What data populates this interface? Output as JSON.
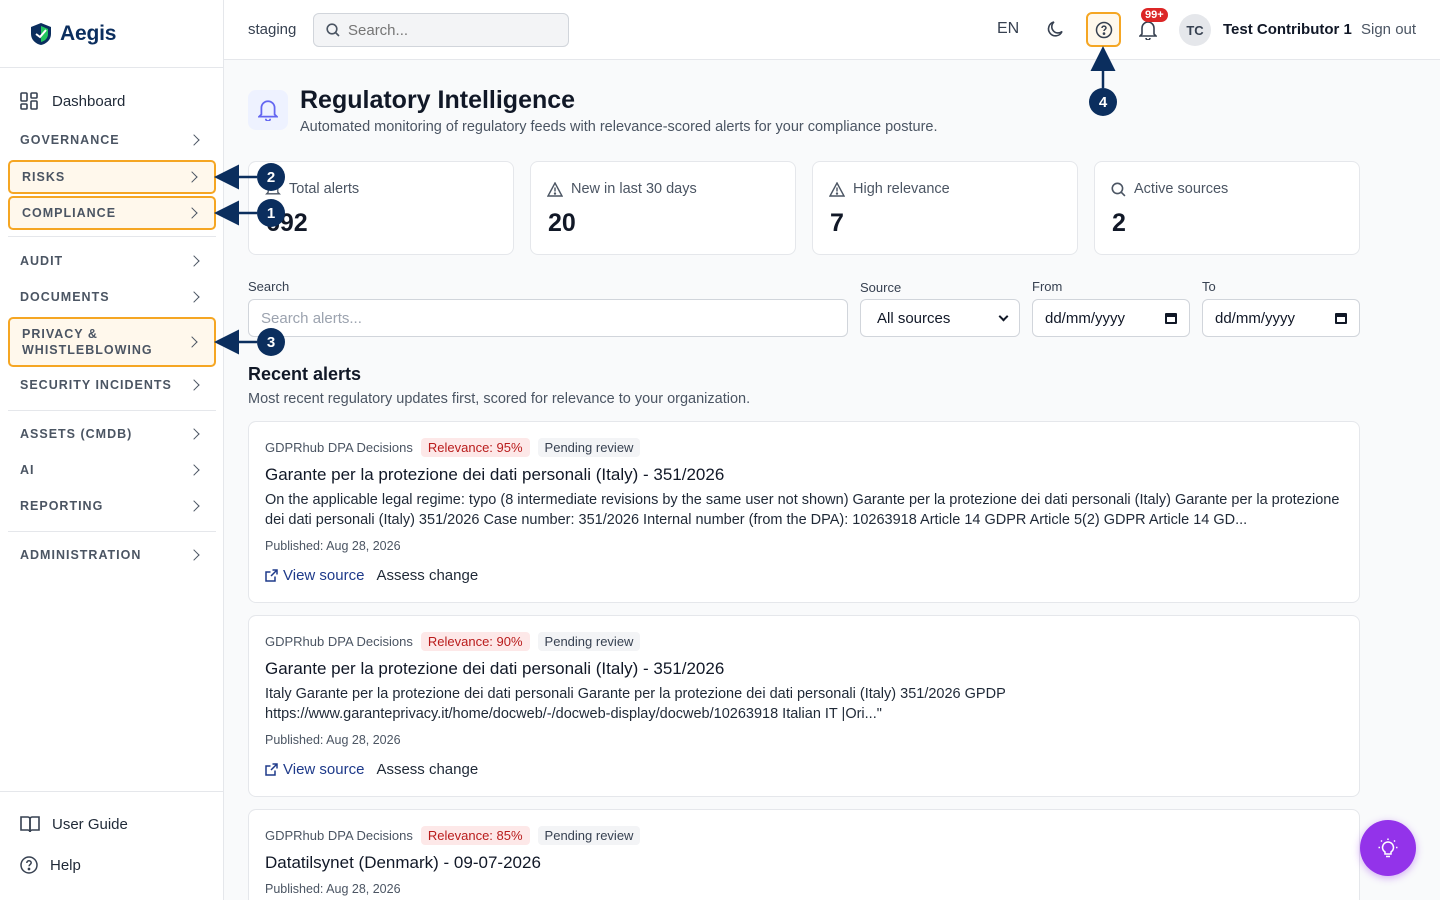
{
  "app": {
    "name": "Aegis",
    "env": "staging"
  },
  "topbar": {
    "search_placeholder": "Search...",
    "language": "EN",
    "notifications_badge": "99+",
    "user_initials": "TC",
    "user_name": "Test Contributor 1",
    "sign_out": "Sign out"
  },
  "sidebar": {
    "dashboard": "Dashboard",
    "sections": [
      "GOVERNANCE",
      "RISKS",
      "COMPLIANCE",
      "AUDIT",
      "DOCUMENTS",
      "PRIVACY & WHISTLEBLOWING",
      "SECURITY INCIDENTS",
      "ASSETS (CMDB)",
      "AI",
      "REPORTING",
      "ADMINISTRATION"
    ],
    "user_guide": "User Guide",
    "help": "Help"
  },
  "page": {
    "title": "Regulatory Intelligence",
    "subtitle": "Automated monitoring of regulatory feeds with relevance-scored alerts for your compliance posture."
  },
  "stats": [
    {
      "label": "Total alerts",
      "value": "692"
    },
    {
      "label": "New in last 30 days",
      "value": "20"
    },
    {
      "label": "High relevance",
      "value": "7"
    },
    {
      "label": "Active sources",
      "value": "2"
    }
  ],
  "filters": {
    "search_label": "Search",
    "search_placeholder": "Search alerts...",
    "source_label": "Source",
    "source_value": "All sources",
    "from_label": "From",
    "from_value": "dd/mm/yyyy",
    "to_label": "To",
    "to_value": "dd/mm/yyyy"
  },
  "recent": {
    "title": "Recent alerts",
    "subtitle": "Most recent regulatory updates first, scored for relevance to your organization."
  },
  "alerts": [
    {
      "source": "GDPRhub DPA Decisions",
      "relevance": "Relevance: 95%",
      "status": "Pending review",
      "title": "Garante per la protezione dei dati personali (Italy) - 351/2026",
      "body": "On the applicable legal regime: typo (8 intermediate revisions by the same user not shown) Garante per la protezione dei dati personali (Italy) Garante per la protezione dei dati personali (Italy) 351/2026 Case number: 351/2026 Internal number (from the DPA): 10263918 Article 14 GDPR Article 5(2) GDPR Article 14 GD...",
      "published": "Published: Aug 28, 2026",
      "view_source": "View source",
      "assess": "Assess change"
    },
    {
      "source": "GDPRhub DPA Decisions",
      "relevance": "Relevance: 90%",
      "status": "Pending review",
      "title": "Garante per la protezione dei dati personali (Italy) - 351/2026",
      "body": "Italy Garante per la protezione dei dati personali Garante per la protezione dei dati personali (Italy) 351/2026 GPDP https://www.garanteprivacy.it/home/docweb/-/docweb-display/docweb/10263918 Italian IT |Ori...\"",
      "published": "Published: Aug 28, 2026",
      "view_source": "View source",
      "assess": "Assess change"
    },
    {
      "source": "GDPRhub DPA Decisions",
      "relevance": "Relevance: 85%",
      "status": "Pending review",
      "title": "Datatilsynet (Denmark) - 09-07-2026",
      "published": "Published: Aug 28, 2026"
    }
  ],
  "annotations": [
    "1",
    "2",
    "3",
    "4"
  ],
  "colors": {
    "highlight": "#f5a623",
    "marker": "#0b2e5e",
    "brand": "#0b2e5e",
    "fab": "#9333ea"
  }
}
